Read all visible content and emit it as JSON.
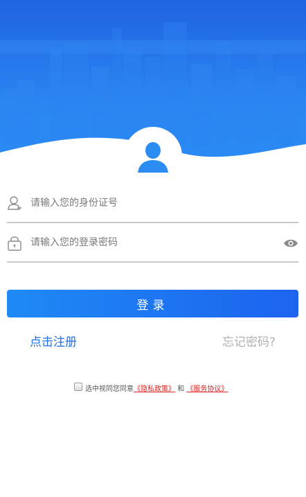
{
  "colors": {
    "brand_blue": "#1f6fe8",
    "hero_top": "#1f63e0",
    "hero_bottom": "#2a8bf4",
    "link_red": "#e02020",
    "muted_gray": "#b0b0b0"
  },
  "header": {
    "avatar_icon": "user-silhouette-icon"
  },
  "form": {
    "id_field": {
      "icon": "user-outline-icon",
      "placeholder": "请输入您的身份证号",
      "value": ""
    },
    "password_field": {
      "icon": "lock-icon",
      "placeholder": "请输入您的登录密码",
      "value": "",
      "toggle_icon": "eye-icon"
    },
    "login_label": "登录"
  },
  "links": {
    "register": "点击注册",
    "forgot": "忘记密码?"
  },
  "agreement": {
    "prefix": "选中视同您同意",
    "privacy": "《隐私政策》",
    "conjunction": "和",
    "service": "《服务协议》",
    "checked": false
  }
}
